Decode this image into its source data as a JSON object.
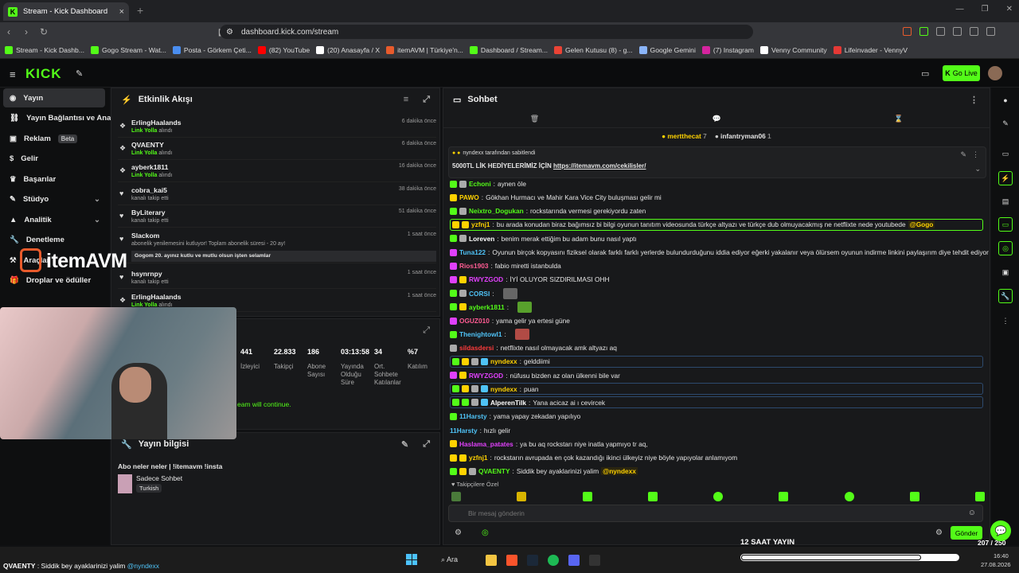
{
  "browser": {
    "tab_title": "Stream - Kick Dashboard",
    "url": "dashboard.kick.com/stream",
    "bookmarks": [
      {
        "label": "Stream - Kick Dashb...",
        "color": "#53fc18"
      },
      {
        "label": "Gogo Stream - Wat...",
        "color": "#53fc18"
      },
      {
        "label": "Posta - Görkem Çeti...",
        "color": "#4a8ef0"
      },
      {
        "label": "(82) YouTube",
        "color": "#ff0000"
      },
      {
        "label": "(20) Anasayfa / X",
        "color": "#ffffff"
      },
      {
        "label": "itemAVM | Türkiye'n...",
        "color": "#e85b2c"
      },
      {
        "label": "Dashboard / Stream...",
        "color": "#53fc18"
      },
      {
        "label": "Gelen Kutusu (8) - g...",
        "color": "#ea4335"
      },
      {
        "label": "Google Gemini",
        "color": "#8ab4f8"
      },
      {
        "label": "(7) Instagram",
        "color": "#d6249f"
      },
      {
        "label": "Venny Community",
        "color": "#ffffff"
      },
      {
        "label": "Lifeinvader - VennyV",
        "color": "#e53935"
      }
    ]
  },
  "header": {
    "logo": "KICK",
    "go_live": "Go Live"
  },
  "sidebar": [
    {
      "label": "Yayın",
      "icon": "dot-icon",
      "active": true
    },
    {
      "label": "Yayın Bağlantısı ve Anahtar",
      "icon": "link-icon"
    },
    {
      "label": "Reklam",
      "icon": "ad-icon",
      "badge": "Beta"
    },
    {
      "label": "Gelir",
      "icon": "dollar-icon"
    },
    {
      "label": "Başarılar",
      "icon": "trophy-icon"
    },
    {
      "label": "Stüdyo",
      "icon": "pen-icon",
      "chevron": true
    },
    {
      "label": "Analitik",
      "icon": "chart-icon",
      "chevron": true
    },
    {
      "label": "Denetleme",
      "icon": "wrench-icon"
    },
    {
      "label": "Araçlar",
      "icon": "tools-icon"
    },
    {
      "label": "Droplar ve ödüller",
      "icon": "gift-icon"
    }
  ],
  "activity": {
    "title": "Etkinlik Akışı",
    "items": [
      {
        "name": "ErlingHaalands",
        "sub_b": "Link Yolla",
        "sub": " alındı",
        "time": "6 dakika önce"
      },
      {
        "name": "QVAENTY",
        "sub_b": "Link Yolla",
        "sub": " alındı",
        "time": "6 dakika önce"
      },
      {
        "name": "ayberk1811",
        "sub_b": "Link Yolla",
        "sub": " alındı",
        "time": "16 dakika önce"
      },
      {
        "name": "cobra_kai5",
        "sub_b": "",
        "sub": "kanalı takip etti",
        "time": "38 dakika önce"
      },
      {
        "name": "ByLiterary",
        "sub_b": "",
        "sub": "kanalı takip etti",
        "time": "51 dakika önce"
      },
      {
        "name": "Slackom",
        "sub_b": "",
        "sub": "abonelik yenilemesini kutluyor! Toplam abonelik süresi - 20 ay!",
        "time": "1 saat önce",
        "note": "Gogom 20. ayınız kutlu ve mutlu olsun işten selamlar"
      },
      {
        "name": "hsynrnpy",
        "sub_b": "",
        "sub": "kanalı takip etti",
        "time": "1 saat önce"
      },
      {
        "name": "ErlingHaalands",
        "sub_b": "Link Yolla",
        "sub": " alındı",
        "time": "1 saat önce"
      }
    ]
  },
  "stats": [
    {
      "value": "441",
      "label": "İzleyici"
    },
    {
      "value": "22.833",
      "label": "Takipçi"
    },
    {
      "value": "186",
      "label": "Abone Sayısı"
    },
    {
      "value": "03:13:58",
      "label": "Yayında Olduğu Süre"
    },
    {
      "value": "34",
      "label": "Ort. Sohbete Katılanlar"
    },
    {
      "value": "%7",
      "label": "Katılım"
    }
  ],
  "stats_message": "eam will continue.",
  "info": {
    "title": "Yayın bilgisi",
    "stream_title": "Abo neler neler | !itemavm !insta",
    "category": "Sadece Sohbet",
    "language": "Turkish"
  },
  "chat": {
    "title": "Sohbet",
    "gifters": [
      {
        "name": "mertthecat",
        "count": "7"
      },
      {
        "name": "infantryman06",
        "count": "1"
      }
    ],
    "pinned_by": "nyndexx tarafından sabitlendi",
    "pinned_text": "5000TL LİK HEDİYELERİMİZ İÇİN ",
    "pinned_link": "https://itemavm.com/cekilisler/",
    "messages": [
      {
        "user": "Echoni",
        "color": "#53fc18",
        "text": "aynen öle",
        "badges": [
          "#53fc18",
          "#aaaaaa"
        ]
      },
      {
        "user": "PAWO",
        "color": "#ffd200",
        "text": "Gökhan Hurmacı ve Mahir Kara Vice City buluşması gelir mi",
        "badges": [
          "#ffd200"
        ]
      },
      {
        "user": "Neixtro_Dogukan",
        "color": "#53fc18",
        "text": "rockstarında vermesi gerekiyordu zaten",
        "badges": [
          "#53fc18",
          "#aaaaaa"
        ]
      },
      {
        "user": "yzfnj1",
        "color": "#ffd200",
        "text": "bu arada konudan biraz bağımsız bi bilgi oyunun tanıtım videosunda türkçe altyazı ve türkçe dub olmuyacakmış ne netflixte nede youtubede ",
        "mention": "@Gogo",
        "badges": [
          "#ffd200",
          "#ffd200"
        ],
        "hl": "g"
      },
      {
        "user": "Loreven",
        "color": "#ffffff",
        "text": "benim merak ettiğim bu adam bunu nasıl yaptı",
        "badges": [
          "#53fc18",
          "#aaaaaa"
        ]
      },
      {
        "user": "Tuna122",
        "color": "#4fc3f7",
        "text": "Oyunun birçok kopyasını fiziksel olarak farklı farklı yerlerde bulundurduğunu iddia ediyor eğerki yakalanır veya ölürsem oyunun indirme linkini paylaşırım diye tehdit ediyor",
        "badges": [
          "#e040fb"
        ]
      },
      {
        "user": "Rios1903",
        "color": "#ff5c93",
        "text": "fabio miretti istanbulda",
        "badges": [
          "#e040fb"
        ]
      },
      {
        "user": "RWYZGOD",
        "color": "#e040fb",
        "text": "İYİ OLUYOR SIZDIRILMASI OHH",
        "badges": [
          "#e040fb",
          "#ffd200"
        ]
      },
      {
        "user": "CORSI",
        "color": "#4fc3f7",
        "text": "",
        "badges": [
          "#53fc18",
          "#aaaaaa"
        ],
        "emote": "#666666"
      },
      {
        "user": "ayberk1811",
        "color": "#53fc18",
        "text": "",
        "badges": [
          "#53fc18",
          "#ffd200"
        ],
        "emote": "#58a02c"
      },
      {
        "user": "OGUZ010",
        "color": "#ff5c93",
        "text": "yama gelir ya ertesi güne",
        "badges": [
          "#e040fb"
        ]
      },
      {
        "user": "Thenightowl1",
        "color": "#4fc3f7",
        "text": "",
        "badges": [
          "#53fc18"
        ],
        "emote": "#b14b45"
      },
      {
        "user": "sildasdersi",
        "color": "#ff3b3b",
        "text": "netflixte nasıl olmayacak amk altyazı aq",
        "badges": [
          "#aaaaaa"
        ]
      },
      {
        "user": "nyndexx",
        "color": "#ffd200",
        "text": "gelddiimi",
        "badges": [
          "#53fc18",
          "#ffd200",
          "#aaaaaa",
          "#4fc3f7"
        ],
        "hl": "b"
      },
      {
        "user": "RWYZGOD",
        "color": "#e040fb",
        "text": "nüfusu bizden az olan ülkenni bile var",
        "badges": [
          "#e040fb",
          "#ffd200"
        ]
      },
      {
        "user": "nyndexx",
        "color": "#ffd200",
        "text": "puan",
        "badges": [
          "#53fc18",
          "#ffd200",
          "#aaaaaa",
          "#4fc3f7"
        ],
        "hl": "b"
      },
      {
        "user": "AlperenTilk",
        "color": "#ffffff",
        "text": "Yana acicaz ai ı cevircek",
        "badges": [
          "#53fc18",
          "#53fc18",
          "#aaaaaa",
          "#4fc3f7"
        ],
        "hl": "b"
      },
      {
        "user": "11Harsty",
        "color": "#4fc3f7",
        "text": "yama yapay zekadan yapılıyo",
        "badges": [
          "#53fc18"
        ]
      },
      {
        "user": "11Harsty",
        "color": "#4fc3f7",
        "text": "hızlı gelir",
        "badges": []
      },
      {
        "user": "Haslama_patates",
        "color": "#e040fb",
        "text": "ya bu aq rockstarı niye inatla yapmıyo tr aq,",
        "badges": [
          "#ffd200"
        ]
      },
      {
        "user": "yzfnj1",
        "color": "#ffd200",
        "text": "rockstarın avrupada en çok kazandığı ikinci ülkeyiz niye böyle yapıyolar anlamıyom",
        "badges": [
          "#ffd200",
          "#ffd200"
        ]
      },
      {
        "user": "QVAENTY",
        "color": "#53fc18",
        "text": "Siddik bey ayaklarinizi yalim ",
        "mention": "@nyndexx",
        "badges": [
          "#53fc18",
          "#ffd200",
          "#aaaaaa"
        ]
      }
    ],
    "followers_only": "Takipçilere Özel",
    "placeholder": "Bir mesaj gönderin",
    "send": "Gönder"
  },
  "overlay": {
    "logo_text": "itemAVM",
    "bottom_title": "12 SAAT YAYIN",
    "bottom_count": "207 / 250",
    "bottom_progress": 0.828,
    "ticker_user": "QVAENTY",
    "ticker_text": " : Siddik bey ayaklarinizi yalim ",
    "ticker_mention": "@nyndexx",
    "clock_time": "16:40",
    "clock_date": "27.08.2026",
    "search": "Ara"
  }
}
